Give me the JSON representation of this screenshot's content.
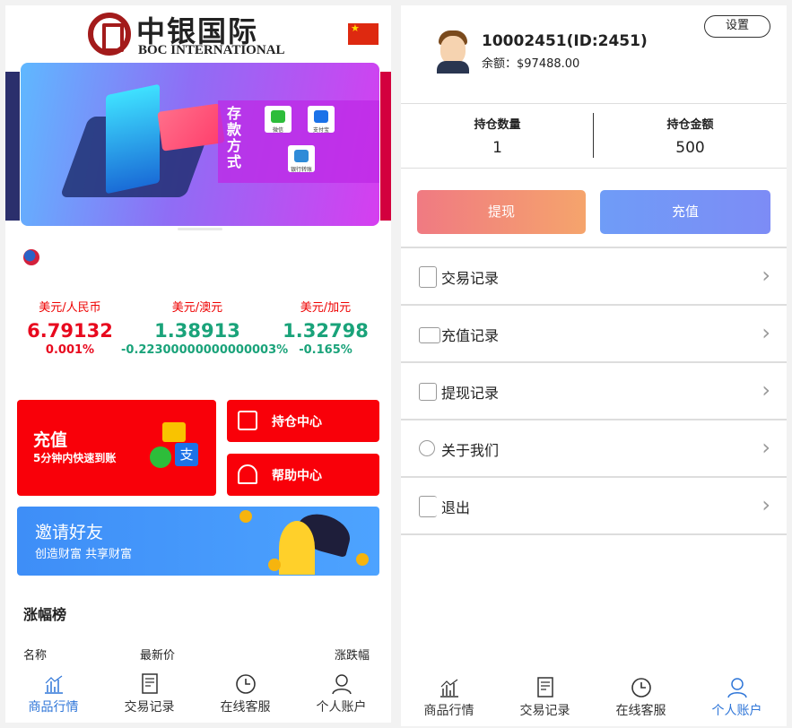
{
  "left": {
    "logo": {
      "cn": "中银国际",
      "en": "BOC INTERNATIONAL"
    },
    "banner": {
      "panel_title": "存款方式",
      "icons": [
        "微信",
        "支付宝",
        "银行转账"
      ]
    },
    "rates": [
      {
        "name": "美元/人民币",
        "price": "6.79132",
        "change": "0.001%",
        "direction": "up"
      },
      {
        "name": "美元/澳元",
        "price": "1.38913",
        "change": "-0.22300000000000003%",
        "direction": "down"
      },
      {
        "name": "美元/加元",
        "price": "1.32798",
        "change": "-0.165%",
        "direction": "down"
      }
    ],
    "recharge": {
      "title": "充值",
      "subtitle": "5分钟内快速到账",
      "alipay_glyph": "支"
    },
    "position_center": "持仓中心",
    "help_center": "帮助中心",
    "invite": {
      "title": "邀请好友",
      "subtitle": "创造财富 共享财富"
    },
    "ranking": {
      "title": "涨幅榜",
      "col_name": "名称",
      "col_price": "最新价",
      "col_change": "涨跌幅"
    },
    "tabs": [
      {
        "label": "商品行情",
        "icon": "chart-icon"
      },
      {
        "label": "交易记录",
        "icon": "document-icon"
      },
      {
        "label": "在线客服",
        "icon": "clock-icon"
      },
      {
        "label": "个人账户",
        "icon": "user-icon"
      }
    ],
    "active_tab": 0
  },
  "right": {
    "user_id": "10002451(ID:2451)",
    "balance": "余额：$97488.00",
    "settings_label": "设置",
    "holding_qty_label": "持仓数量",
    "holding_qty": "1",
    "holding_amount_label": "持仓金额",
    "holding_amount": "500",
    "withdraw_label": "提现",
    "deposit_label": "充值",
    "menu": [
      {
        "label": "交易记录",
        "icon": "clipboard-icon"
      },
      {
        "label": "充值记录",
        "icon": "wallet-icon"
      },
      {
        "label": "提现记录",
        "icon": "calendar-icon"
      },
      {
        "label": "关于我们",
        "icon": "users-icon"
      },
      {
        "label": "退出",
        "icon": "logout-icon"
      }
    ],
    "tabs": [
      {
        "label": "商品行情",
        "icon": "chart-icon"
      },
      {
        "label": "交易记录",
        "icon": "document-icon"
      },
      {
        "label": "在线客服",
        "icon": "clock-icon"
      },
      {
        "label": "个人账户",
        "icon": "user-icon"
      }
    ],
    "active_tab": 3
  },
  "colors": {
    "brand_red": "#f90009",
    "up": "#e8091e",
    "down": "#1aa37a",
    "active_tab": "#2f76d8"
  }
}
